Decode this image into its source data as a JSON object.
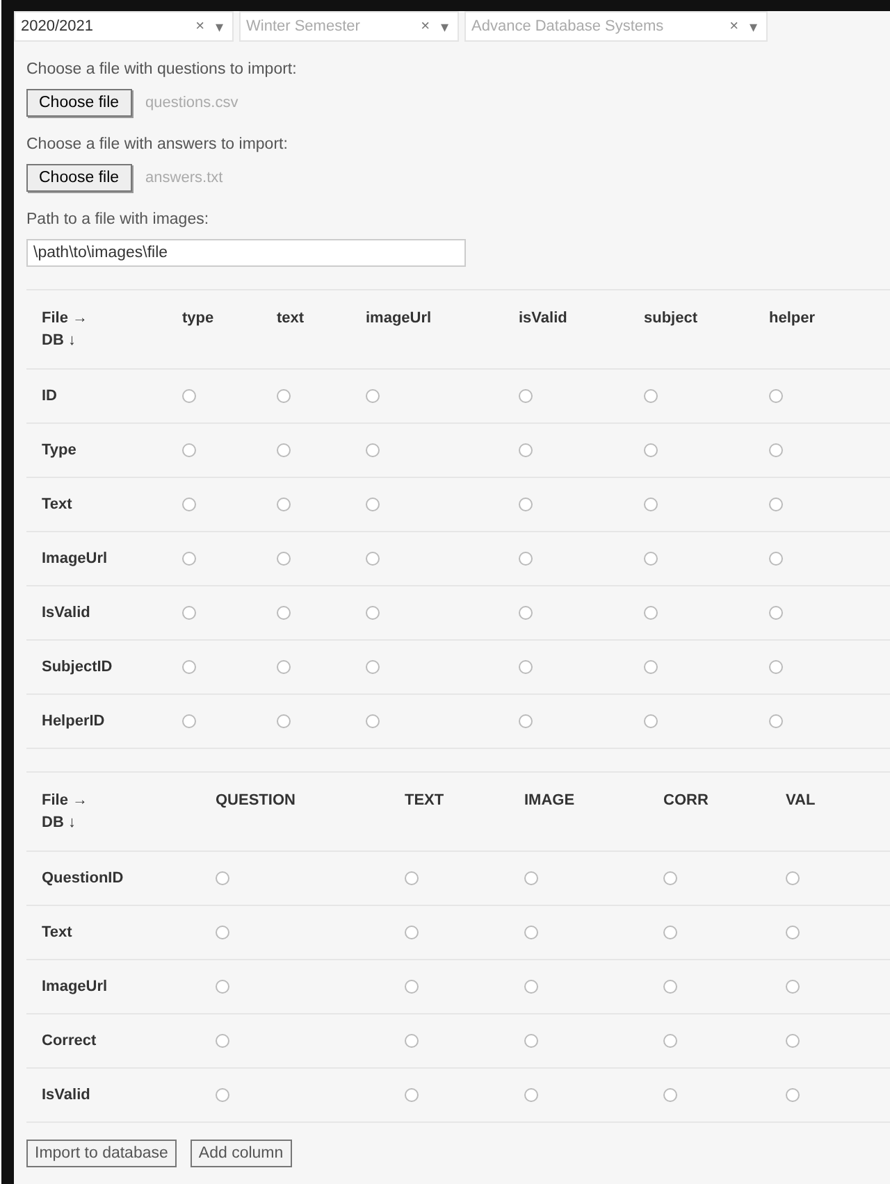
{
  "selects": [
    {
      "value": "2020/2021",
      "placeholder": false
    },
    {
      "value": "Winter Semester",
      "placeholder": true
    },
    {
      "value": "Advance Database Systems",
      "placeholder": true
    }
  ],
  "clear_glyph": "×",
  "caret_glyph": "▾",
  "file_inputs": [
    {
      "label": "Choose a file with questions to import:",
      "button": "Choose file",
      "file": "questions.csv"
    },
    {
      "label": "Choose a file with answers to import:",
      "button": "Choose file",
      "file": "answers.txt"
    }
  ],
  "path_field": {
    "label": "Path to a file with images:",
    "value": "\\path\\to\\images\\file"
  },
  "tables": [
    {
      "corner": [
        "File →",
        "DB ↓"
      ],
      "columns": [
        "type",
        "text",
        "imageUrl",
        "isValid",
        "subject",
        "helper"
      ],
      "rows": [
        {
          "label": "ID",
          "cells": [
            {
              "selected": false
            },
            {
              "selected": false
            },
            {
              "selected": false
            },
            {
              "selected": false
            },
            {
              "selected": false
            },
            {
              "selected": false
            }
          ]
        },
        {
          "label": "Type",
          "cells": [
            {
              "selected": false
            },
            {
              "selected": false
            },
            {
              "selected": false
            },
            {
              "selected": false
            },
            {
              "selected": false
            },
            {
              "selected": false
            }
          ]
        },
        {
          "label": "Text",
          "cells": [
            {
              "selected": false
            },
            {
              "selected": false
            },
            {
              "selected": false
            },
            {
              "selected": false
            },
            {
              "selected": false
            },
            {
              "selected": false
            }
          ]
        },
        {
          "label": "ImageUrl",
          "cells": [
            {
              "selected": false
            },
            {
              "selected": false
            },
            {
              "selected": false
            },
            {
              "selected": false
            },
            {
              "selected": false
            },
            {
              "selected": false
            }
          ]
        },
        {
          "label": "IsValid",
          "cells": [
            {
              "selected": false
            },
            {
              "selected": false
            },
            {
              "selected": false
            },
            {
              "selected": false
            },
            {
              "selected": false
            },
            {
              "selected": false
            }
          ]
        },
        {
          "label": "SubjectID",
          "cells": [
            {
              "selected": false
            },
            {
              "selected": false
            },
            {
              "selected": false
            },
            {
              "selected": false
            },
            {
              "selected": false
            },
            {
              "selected": false
            }
          ]
        },
        {
          "label": "HelperID",
          "cells": [
            {
              "selected": false
            },
            {
              "selected": false
            },
            {
              "selected": false
            },
            {
              "selected": false
            },
            {
              "selected": false
            },
            {
              "selected": false
            }
          ]
        }
      ]
    },
    {
      "corner": [
        "File →",
        "DB ↓"
      ],
      "columns": [
        "QUESTION",
        "TEXT",
        "IMAGE",
        "CORR",
        "VAL"
      ],
      "rows": [
        {
          "label": "QuestionID",
          "cells": [
            {
              "selected": false
            },
            {
              "selected": false
            },
            {
              "selected": false
            },
            {
              "selected": false
            },
            {
              "selected": false
            }
          ]
        },
        {
          "label": "Text",
          "cells": [
            {
              "selected": false
            },
            {
              "selected": false
            },
            {
              "selected": false
            },
            {
              "selected": false
            },
            {
              "selected": false
            }
          ]
        },
        {
          "label": "ImageUrl",
          "cells": [
            {
              "selected": false
            },
            {
              "selected": false
            },
            {
              "selected": false
            },
            {
              "selected": false
            },
            {
              "selected": false
            }
          ]
        },
        {
          "label": "Correct",
          "cells": [
            {
              "selected": false
            },
            {
              "selected": false
            },
            {
              "selected": false
            },
            {
              "selected": false
            },
            {
              "selected": false
            }
          ]
        },
        {
          "label": "IsValid",
          "cells": [
            {
              "selected": false
            },
            {
              "selected": false
            },
            {
              "selected": false
            },
            {
              "selected": false
            },
            {
              "selected": false
            }
          ]
        }
      ]
    }
  ],
  "buttons": [
    "Import to database",
    "Add column"
  ]
}
